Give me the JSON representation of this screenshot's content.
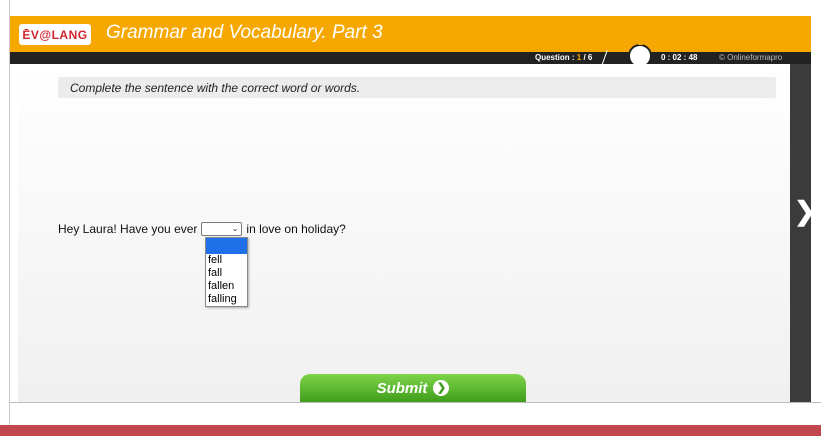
{
  "header": {
    "logo": "ĒV@LANG",
    "title": "Grammar and Vocabulary. Part 3"
  },
  "status_bar": {
    "question_prefix": "Question : ",
    "question_current": "1",
    "question_total": " / 6",
    "timer": "0 : 02 : 48",
    "copyright": "© Onlineformapro"
  },
  "main": {
    "instruction": "Complete the sentence with the correct word or words.",
    "sentence_before": "Hey Laura! Have you ever",
    "sentence_after": "in love on holiday?",
    "dropdown_selected": "",
    "dropdown_options": [
      "",
      "fell",
      "fall",
      "fallen",
      "falling"
    ]
  },
  "buttons": {
    "submit": "Submit",
    "next_arrow": "❯"
  },
  "colors": {
    "accent": "#f7a800",
    "dark": "#222222",
    "submit_green": "#4caf22",
    "footer": "#c2464e"
  }
}
